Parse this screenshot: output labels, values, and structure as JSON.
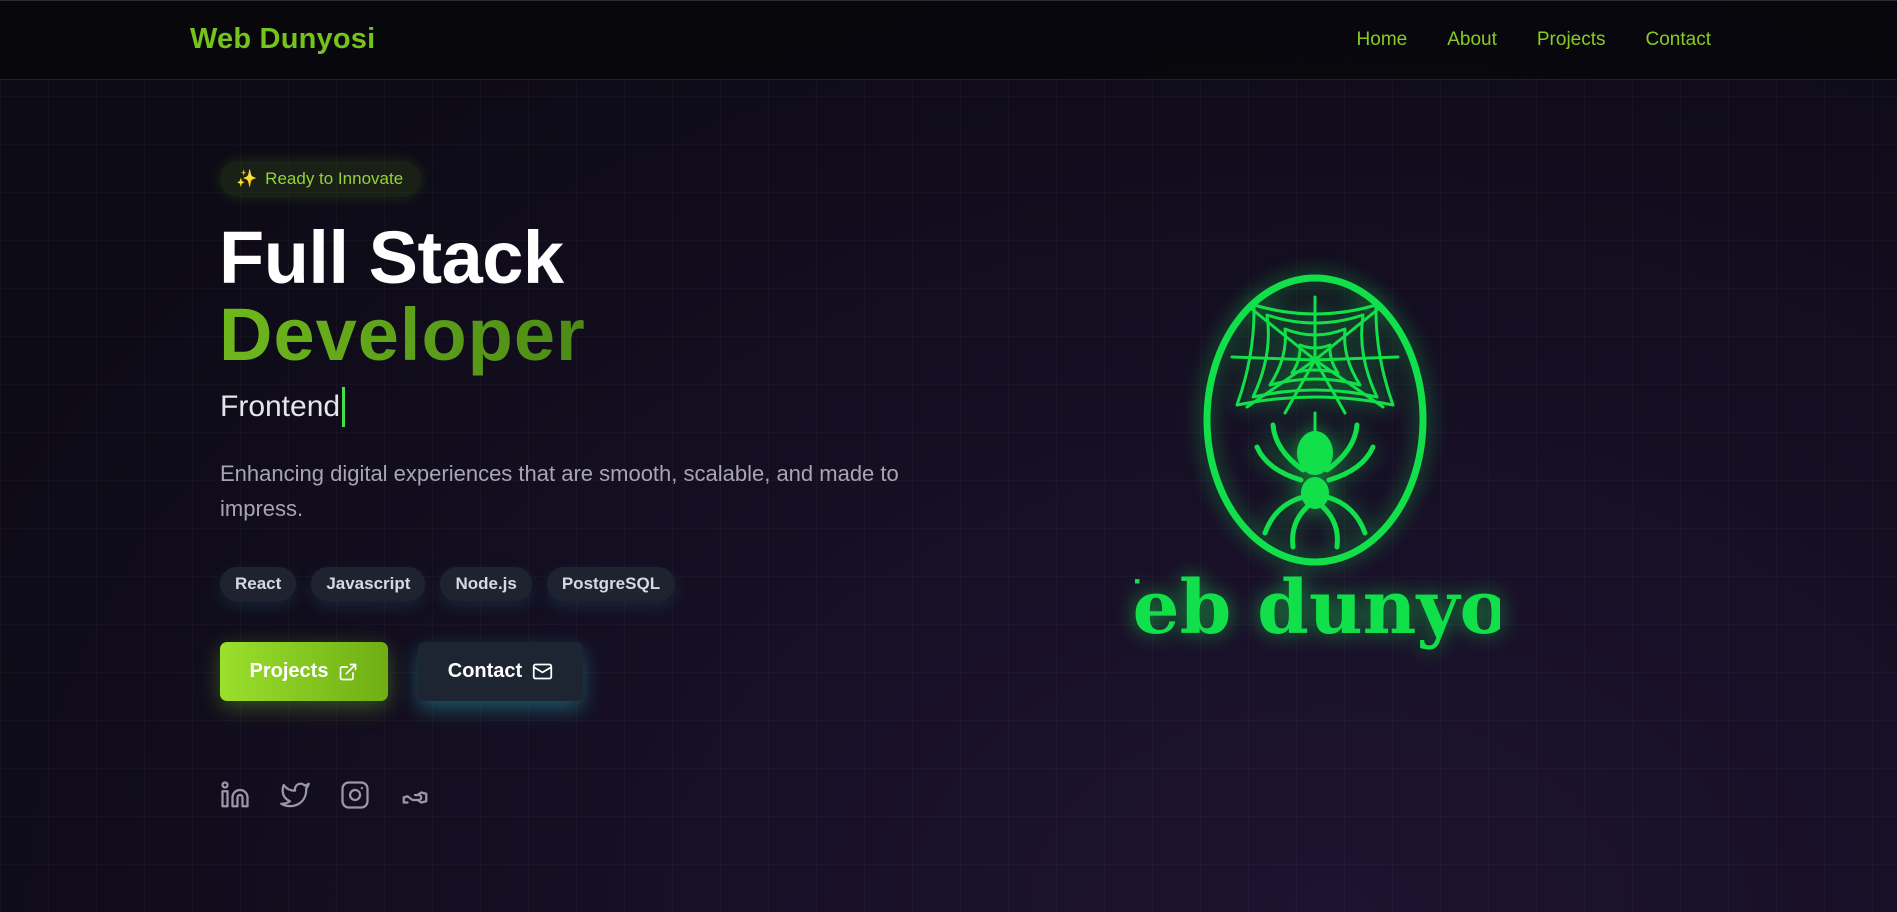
{
  "nav": {
    "brand": "Web Dunyosi",
    "links": [
      "Home",
      "About",
      "Projects",
      "Contact"
    ]
  },
  "hero": {
    "badge_icon": "sparkles-icon",
    "badge": "Ready to Innovate",
    "title_line1": "Full Stack",
    "title_line2": "Developer",
    "typing_text": "Frontend",
    "description": "Enhancing digital experiences that are smooth, scalable, and made to impress.",
    "tags": [
      "React",
      "Javascript",
      "Node.js",
      "PostgreSQL"
    ],
    "buttons": {
      "projects": {
        "label": "Projects",
        "icon": "external-link-icon"
      },
      "contact": {
        "label": "Contact",
        "icon": "mail-icon"
      }
    },
    "socials": [
      "linkedin-icon",
      "twitter-icon",
      "instagram-icon",
      "handshake-icon"
    ]
  },
  "logo": {
    "text": "Web dunyosi"
  },
  "colors": {
    "accent_green": "#74c41c",
    "neon_green": "#12e04a",
    "background": "#120d1d"
  }
}
